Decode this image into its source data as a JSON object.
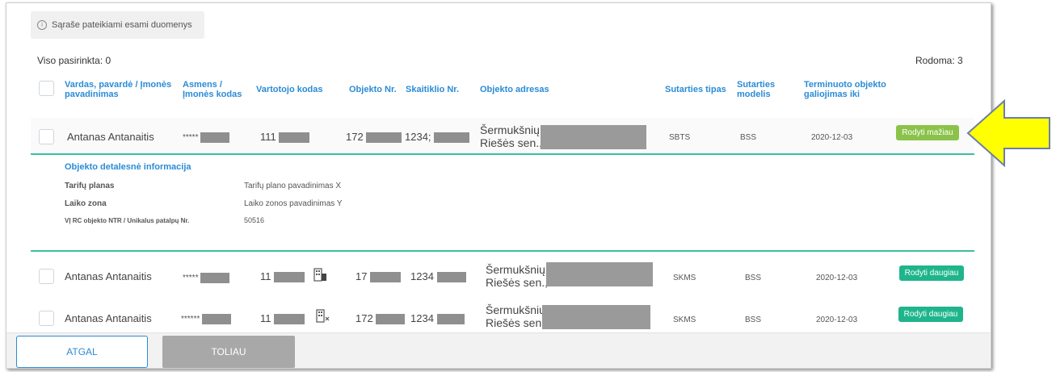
{
  "notice": {
    "icon": "info-icon",
    "text": "Sąraše pateikiami esami duomenys"
  },
  "selection": {
    "selected_label": "Viso pasirinkta: 0",
    "shown_label": "Rodoma: 3"
  },
  "columns": {
    "name": "Vardas, pavardė / Įmonės pavadinimas",
    "person_code": "Asmens / Įmonės kodas",
    "consumer_code": "Vartotojo kodas",
    "object_no": "Objekto Nr.",
    "meter_no": "Skaitiklio Nr.",
    "address": "Objekto adresas",
    "contract_type": "Sutarties tipas",
    "contract_model": "Sutarties modelis",
    "expiry": "Terminuoto objekto galiojimas iki"
  },
  "rows": [
    {
      "name": "Antanas Antanaitis",
      "person_code": "*****",
      "consumer_code": "111",
      "object_no": "172",
      "meter_no": "1234;",
      "address_line1": "Šermukšnių",
      "address_line2": "Riešės sen.,",
      "contract_type": "SBTS",
      "contract_model": "BSS",
      "expiry": "2020-12-03",
      "action": "Rodyti mažiau"
    },
    {
      "name": "Antanas Antanaitis",
      "person_code": "*****",
      "consumer_code": "11",
      "object_no": "17",
      "meter_no": "1234",
      "address_line1": "Šermukšnių",
      "address_line2": "Riešės sen.,",
      "contract_type": "SKMS",
      "contract_model": "BSS",
      "expiry": "2020-12-03",
      "action": "Rodyti daugiau"
    },
    {
      "name": "Antanas Antanaitis",
      "person_code": "******",
      "consumer_code": "11",
      "object_no": "172",
      "meter_no": "1234",
      "address_line1": "Šermukšnių",
      "address_line2": "Riešės sen.,",
      "contract_type": "SKMS",
      "contract_model": "BSS",
      "expiry": "2020-12-03",
      "action": "Rodyti daugiau"
    }
  ],
  "details": {
    "title": "Objekto detalesnė informacija",
    "items": [
      {
        "label": "Tarifų planas",
        "value": "Tarifų plano pavadinimas X"
      },
      {
        "label": "Laiko zona",
        "value": "Laiko zonos pavadinimas Y"
      },
      {
        "label": "VĮ RC objekto NTR / Unikalus patalpų Nr.",
        "value": "50516"
      }
    ]
  },
  "footer": {
    "back": "ATGAL",
    "next": "TOLIAU"
  },
  "colors": {
    "accent": "#2a8bd6",
    "teal": "#1fb58c",
    "green": "#8bc34a",
    "arrow": "#ffff00"
  }
}
